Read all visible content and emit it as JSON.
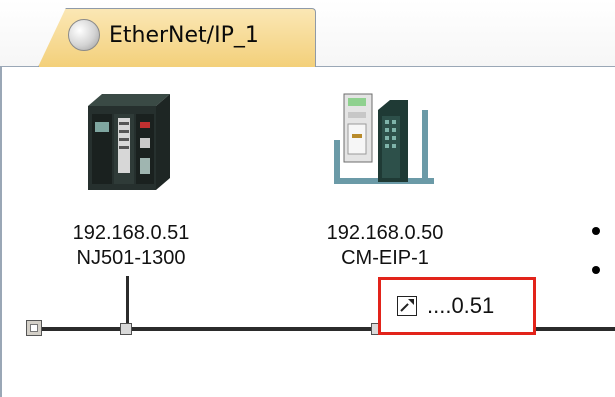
{
  "tab": {
    "label": "EtherNet/IP_1",
    "icon": "globe-icon"
  },
  "devices": [
    {
      "ip": "192.168.0.51",
      "model": "NJ501-1300",
      "icon": "plc-controller-icon"
    },
    {
      "ip": "192.168.0.50",
      "model": "CM-EIP-1",
      "icon": "ethernet-ip-module-icon"
    }
  ],
  "bus": {
    "end_icon": "bus-terminator-icon"
  },
  "node_address": {
    "label": "....0.51",
    "icon": "shortcut-link-icon",
    "highlight_color": "#e2231a"
  }
}
